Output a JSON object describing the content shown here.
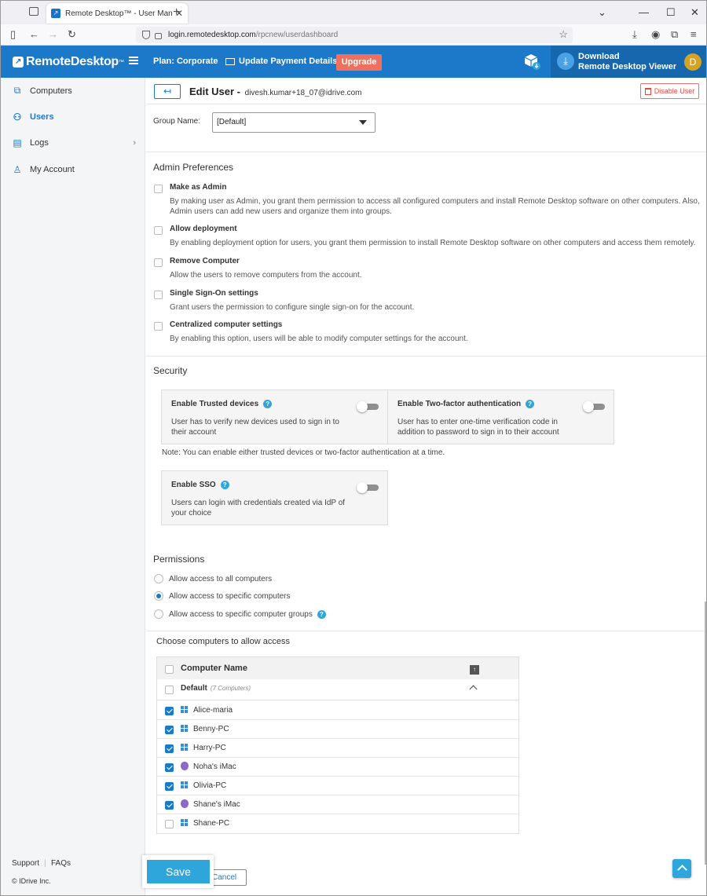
{
  "browser": {
    "tab_title": "Remote Desktop™ - User Mana",
    "url_host": "login.remotedesktop.com",
    "url_path": "/rpcnew/userdashboard"
  },
  "header": {
    "logo": "RemoteDesktop",
    "logo_tm": "™",
    "plan_label": "Plan: Corporate",
    "update_payment": "Update Payment Details",
    "upgrade": "Upgrade",
    "download_line1": "Download",
    "download_line2": "Remote Desktop Viewer",
    "avatar_initial": "D"
  },
  "sidebar": {
    "items": [
      {
        "label": "Computers",
        "icon": "computers-icon"
      },
      {
        "label": "Users",
        "icon": "users-icon"
      },
      {
        "label": "Logs",
        "icon": "logs-icon"
      },
      {
        "label": "My Account",
        "icon": "account-icon"
      }
    ],
    "support": "Support",
    "faqs": "FAQs",
    "separator": "|",
    "copyright": "© IDrive Inc."
  },
  "page": {
    "back_icon": "↤",
    "title": "Edit User -",
    "email": "divesh.kumar+18_07@idrive.com",
    "disable_user": "Disable User",
    "group_label": "Group Name:",
    "group_value": "[Default]"
  },
  "admin": {
    "heading": "Admin Preferences",
    "items": [
      {
        "title": "Make as Admin",
        "desc": "By making user as Admin, you grant them permission to access all configured computers and install Remote Desktop software on other computers. Also, Admin users can add new users and organize them into groups.",
        "checked": false
      },
      {
        "title": "Allow deployment",
        "desc": "By enabling deployment option for users, you grant them permission to install Remote Desktop software on other computers and access them remotely.",
        "checked": false
      },
      {
        "title": "Remove Computer",
        "desc": "Allow the users to remove computers from the account.",
        "checked": false
      },
      {
        "title": "Single Sign-On settings",
        "desc": "Grant users the permission to configure single sign-on for the account.",
        "checked": false
      },
      {
        "title": "Centralized computer settings",
        "desc": "By enabling this option, users will be able to modify computer settings for the account.",
        "checked": false
      }
    ]
  },
  "security": {
    "heading": "Security",
    "trusted_title": "Enable Trusted devices",
    "trusted_desc": "User has to verify new devices used to sign in to their account",
    "twofa_title": "Enable Two-factor authentication",
    "twofa_desc": "User has to enter one-time verification code in addition to password to sign in to their account",
    "note": "Note: You can enable either trusted devices or two-factor authentication at a time.",
    "sso_title": "Enable SSO",
    "sso_desc": "Users can login with credentials created via IdP of your choice",
    "help": "?",
    "toggles_on": [
      false,
      false,
      false
    ]
  },
  "permissions": {
    "heading": "Permissions",
    "options": [
      {
        "label": "Allow access to all computers",
        "selected": false
      },
      {
        "label": "Allow access to specific computers",
        "selected": true
      },
      {
        "label": "Allow access to specific computer groups",
        "selected": false
      }
    ]
  },
  "computers": {
    "heading": "Choose computers to allow access",
    "column": "Computer Name",
    "group_name": "Default",
    "group_count": "(7 Computers)",
    "rows": [
      {
        "name": "Alice-maria",
        "os": "windows",
        "checked": true
      },
      {
        "name": "Benny-PC",
        "os": "windows",
        "checked": true
      },
      {
        "name": "Harry-PC",
        "os": "windows",
        "checked": true
      },
      {
        "name": "Noha's iMac",
        "os": "mac",
        "checked": true
      },
      {
        "name": "Olivia-PC",
        "os": "windows",
        "checked": true
      },
      {
        "name": "Shane's iMac",
        "os": "mac",
        "checked": true
      },
      {
        "name": "Shane-PC",
        "os": "windows",
        "checked": false
      }
    ]
  },
  "actions": {
    "save": "Save",
    "cancel": "Cancel",
    "to_top": "scroll-to-top"
  }
}
